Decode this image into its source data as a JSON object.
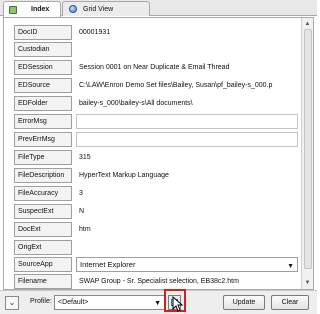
{
  "tabs": [
    {
      "label": "Index",
      "icon": "index-icon",
      "active": true
    },
    {
      "label": "Grid View",
      "icon": "globe-icon",
      "active": false
    }
  ],
  "fields": [
    {
      "label": "DocID",
      "value": "00001931",
      "kind": "text"
    },
    {
      "label": "Custodian",
      "value": "",
      "kind": "text"
    },
    {
      "label": "EDSession",
      "value": "Session 0001 on Near Duplicate & Email Thread",
      "kind": "text"
    },
    {
      "label": "EDSource",
      "value": "C:\\LAW\\Enron Demo Set files\\Bailey, Susan\\pf_bailey-s_000.p",
      "kind": "text"
    },
    {
      "label": "EDFolder",
      "value": "bailey-s_000\\bailey-s\\All documents\\",
      "kind": "text"
    },
    {
      "label": "ErrorMsg",
      "value": "",
      "kind": "input"
    },
    {
      "label": "PrevErrMsg",
      "value": "",
      "kind": "input"
    },
    {
      "label": "FileType",
      "value": "315",
      "kind": "text"
    },
    {
      "label": "FileDescription",
      "value": "HyperText Markup Language",
      "kind": "text"
    },
    {
      "label": "FileAccuracy",
      "value": "3",
      "kind": "text"
    },
    {
      "label": "SuspectExt",
      "value": "N",
      "kind": "text"
    },
    {
      "label": "DocExt",
      "value": "htm",
      "kind": "text"
    },
    {
      "label": "OrigExt",
      "value": "",
      "kind": "text"
    },
    {
      "label": "SourceApp",
      "value": "Internet Explorer",
      "kind": "select"
    },
    {
      "label": "Filename",
      "value": "SWAP Group - Sr. Specialist selection, EB38c2.htm",
      "kind": "text"
    }
  ],
  "footer": {
    "profile_label": "Profile:",
    "profile_value": "<Default>",
    "update_label": "Update",
    "clear_label": "Clear"
  },
  "colors": {
    "highlight": "#d21f1f"
  }
}
